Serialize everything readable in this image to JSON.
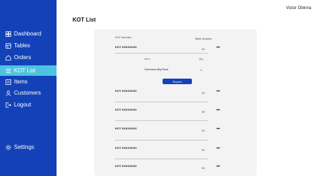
{
  "header": {
    "user_name": "Victor Obinna"
  },
  "page": {
    "title": "KOT List"
  },
  "sidebar": {
    "items": [
      {
        "label": "Dashboard",
        "icon": "dashboard-icon"
      },
      {
        "label": "Tables",
        "icon": "tables-icon"
      },
      {
        "label": "Orders",
        "icon": "orders-icon"
      },
      {
        "label": "KOT List",
        "icon": "kot-list-icon",
        "active": true
      },
      {
        "label": "Items",
        "icon": "items-icon"
      },
      {
        "label": "Customers",
        "icon": "customers-icon"
      },
      {
        "label": "Logout",
        "icon": "logout-icon"
      }
    ],
    "settings": {
      "label": "Settings",
      "icon": "gear-icon"
    }
  },
  "colors": {
    "sidebar": "#1342b8",
    "active": "#4ec3e0",
    "card": "#f3f3f3"
  },
  "table": {
    "col_kot": "KOT Number",
    "col_table": "Table Number",
    "rows": [
      {
        "kot": "KOT XXXXXXXX",
        "table": "06",
        "menu": "•••"
      },
      {
        "kot": "KOT XXXXXXXX",
        "table": "06",
        "menu": "•••"
      },
      {
        "kot": "KOT XXXXXXXX",
        "table": "06",
        "menu": "•••"
      },
      {
        "kot": "KOT XXXXXXXX",
        "table": "06",
        "menu": "•••"
      },
      {
        "kot": "KOT XXXXXXXX",
        "table": "06",
        "menu": "•••"
      },
      {
        "kot": "KOT XXXXXXXX",
        "table": "06",
        "menu": "•••"
      }
    ],
    "expanded": {
      "col_item": "Item",
      "col_qty": "Qty",
      "item_name": "Guinness Big Stout",
      "item_qty": "1",
      "reprint_label": "Reprint"
    }
  }
}
